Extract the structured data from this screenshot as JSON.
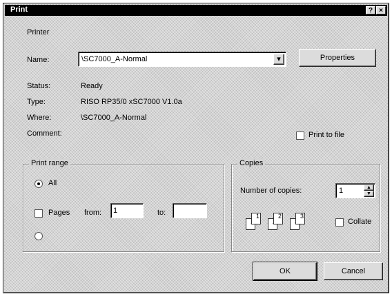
{
  "window": {
    "title": "Print",
    "help_label": "?",
    "close_label": "×"
  },
  "printer": {
    "group_label": "Printer",
    "name_label": "Name:",
    "name_value": "\\SC7000_A-Normal",
    "dropdown_arrow": "▾",
    "properties_label": "Properties",
    "status_label": "Status:",
    "status_value": "Ready",
    "type_label": "Type:",
    "type_value": "RISO RP35/0 xSC7000 V1.0a",
    "where_label": "Where:",
    "where_value": "\\SC7000_A-Normal",
    "comment_label": "Comment:",
    "print_to_file_label": "Print to file"
  },
  "print_range": {
    "group_label": "Print range",
    "all_label": "All",
    "pages_label": "Pages",
    "from_label": "from:",
    "to_label": "to:",
    "from_value": "1",
    "to_value": "",
    "selected": "all"
  },
  "copies": {
    "group_label": "Copies",
    "number_label": "Number of copies:",
    "number_value": "1",
    "collate_label": "Collate",
    "page_numbers": [
      "1",
      "1",
      "2",
      "2",
      "3",
      "3"
    ]
  },
  "buttons": {
    "ok_label": "OK",
    "cancel_label": "Cancel"
  }
}
